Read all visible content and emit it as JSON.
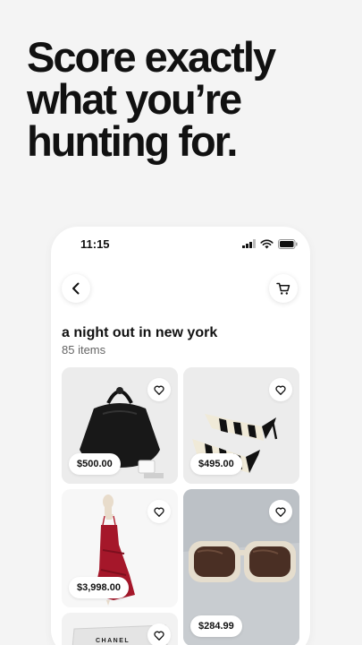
{
  "headline": [
    "Score exactly",
    "what you’re",
    "hunting for."
  ],
  "status_bar": {
    "time": "11:15"
  },
  "page": {
    "title": "a night out in new york",
    "item_count": "85 items"
  },
  "products": [
    {
      "price": "$500.00",
      "image": "black leather handbag"
    },
    {
      "price": "$495.00",
      "image": "striped pointed heels"
    },
    {
      "price": "$3,998.00",
      "image": "red dress on mannequin"
    },
    {
      "price": "$284.99",
      "image": "sunglasses"
    },
    {
      "brand": "CHANEL",
      "image": "chanel box"
    }
  ],
  "colors": {
    "background": "#f4f4f4",
    "text": "#111111"
  }
}
